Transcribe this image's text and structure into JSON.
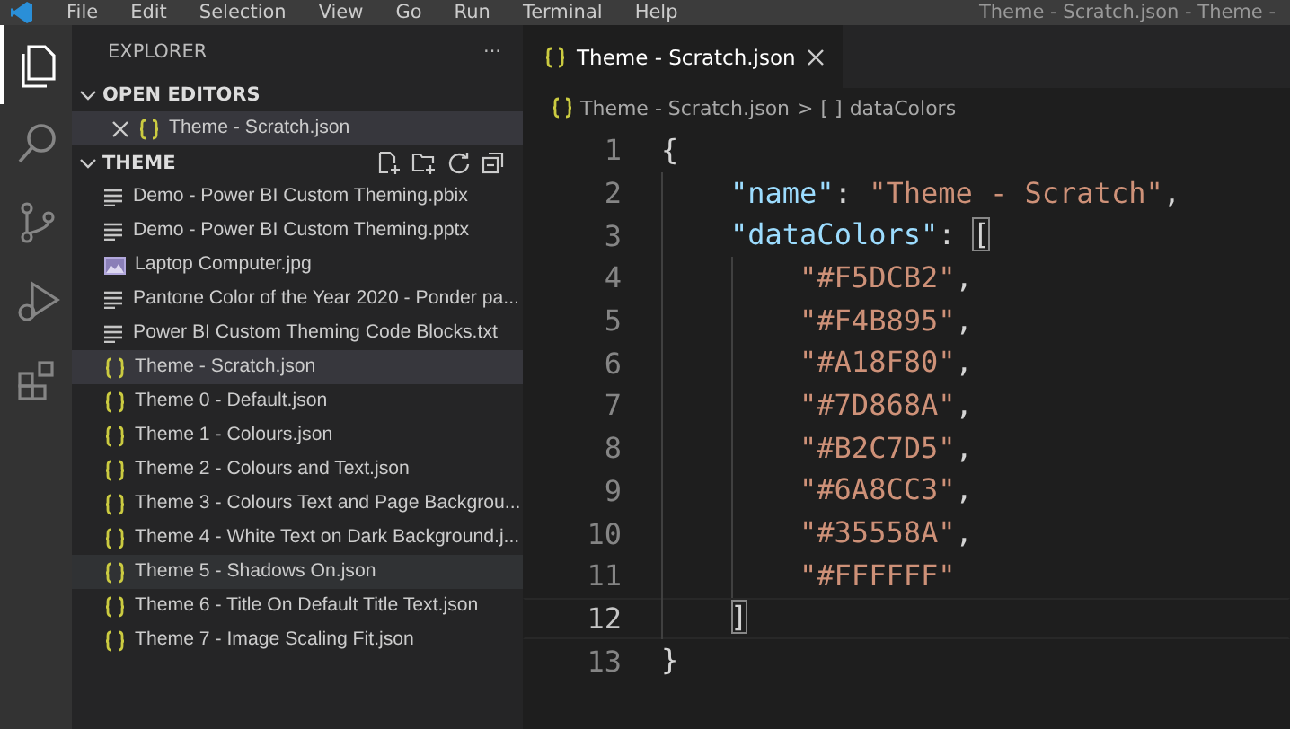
{
  "menu_bar": {
    "items": [
      "File",
      "Edit",
      "Selection",
      "View",
      "Go",
      "Run",
      "Terminal",
      "Help"
    ],
    "window_title": "Theme - Scratch.json - Theme -"
  },
  "activity_bar": [
    {
      "kind": "files",
      "selected": true
    },
    {
      "kind": "search",
      "selected": false
    },
    {
      "kind": "source-control",
      "selected": false
    },
    {
      "kind": "run",
      "selected": false
    },
    {
      "kind": "extensions",
      "selected": false
    }
  ],
  "sidebar": {
    "title": "EXPLORER",
    "more": "···",
    "open_editors": {
      "label": "OPEN EDITORS",
      "expanded": true,
      "items": [
        {
          "name": "Theme - Scratch.json",
          "kind": "json",
          "selected": true
        }
      ]
    },
    "folder": {
      "label": "THEME",
      "expanded": true,
      "items": [
        {
          "name": "Demo - Power BI Custom Theming.pbix",
          "kind": "text",
          "selected": false,
          "hovered": false
        },
        {
          "name": "Demo - Power BI Custom Theming.pptx",
          "kind": "text",
          "selected": false,
          "hovered": false
        },
        {
          "name": "Laptop Computer.jpg",
          "kind": "image",
          "selected": false,
          "hovered": false
        },
        {
          "name": "Pantone Color of the Year 2020 - Ponder pa...",
          "kind": "text",
          "selected": false,
          "hovered": false
        },
        {
          "name": "Power BI Custom Theming Code Blocks.txt",
          "kind": "text",
          "selected": false,
          "hovered": false
        },
        {
          "name": "Theme - Scratch.json",
          "kind": "json",
          "selected": true,
          "hovered": false
        },
        {
          "name": "Theme 0 - Default.json",
          "kind": "json",
          "selected": false,
          "hovered": false
        },
        {
          "name": "Theme 1 - Colours.json",
          "kind": "json",
          "selected": false,
          "hovered": false
        },
        {
          "name": "Theme 2 - Colours and Text.json",
          "kind": "json",
          "selected": false,
          "hovered": false
        },
        {
          "name": "Theme 3 - Colours Text and Page Backgrou...",
          "kind": "json",
          "selected": false,
          "hovered": false
        },
        {
          "name": "Theme 4 - White Text on Dark Background.j...",
          "kind": "json",
          "selected": false,
          "hovered": false
        },
        {
          "name": "Theme 5 - Shadows On.json",
          "kind": "json",
          "selected": false,
          "hovered": true
        },
        {
          "name": "Theme 6 - Title On Default Title Text.json",
          "kind": "json",
          "selected": false,
          "hovered": false
        },
        {
          "name": "Theme 7 - Image Scaling Fit.json",
          "kind": "json",
          "selected": false,
          "hovered": false
        }
      ]
    }
  },
  "editor": {
    "tabs": [
      {
        "label": "Theme - Scratch.json",
        "kind": "json",
        "selected": true
      }
    ],
    "breadcrumb": {
      "file": "Theme - Scratch.json",
      "separator": ">",
      "symbol_icon": "[ ]",
      "symbol": "dataColors"
    },
    "lines": [
      {
        "number": "1",
        "kind": "root",
        "current": false,
        "tokens": [
          {
            "kind": "punct",
            "text": "{"
          }
        ]
      },
      {
        "number": "2",
        "kind": "member",
        "current": false,
        "tokens": [
          {
            "kind": "key",
            "text": "\"name\""
          },
          {
            "kind": "punct",
            "text": ": "
          },
          {
            "kind": "string",
            "text": "\"Theme - Scratch\""
          },
          {
            "kind": "punct",
            "text": ","
          }
        ]
      },
      {
        "number": "3",
        "kind": "member",
        "current": false,
        "tokens": [
          {
            "kind": "key",
            "text": "\"dataColors\""
          },
          {
            "kind": "punct",
            "text": ": "
          },
          {
            "kind": "bracket-match",
            "text": "["
          }
        ]
      },
      {
        "number": "4",
        "kind": "element",
        "current": false,
        "tokens": [
          {
            "kind": "string",
            "text": "\"#F5DCB2\""
          },
          {
            "kind": "punct",
            "text": ","
          }
        ]
      },
      {
        "number": "5",
        "kind": "element",
        "current": false,
        "tokens": [
          {
            "kind": "string",
            "text": "\"#F4B895\""
          },
          {
            "kind": "punct",
            "text": ","
          }
        ]
      },
      {
        "number": "6",
        "kind": "element",
        "current": false,
        "tokens": [
          {
            "kind": "string",
            "text": "\"#A18F80\""
          },
          {
            "kind": "punct",
            "text": ","
          }
        ]
      },
      {
        "number": "7",
        "kind": "element",
        "current": false,
        "tokens": [
          {
            "kind": "string",
            "text": "\"#7D868A\""
          },
          {
            "kind": "punct",
            "text": ","
          }
        ]
      },
      {
        "number": "8",
        "kind": "element",
        "current": false,
        "tokens": [
          {
            "kind": "string",
            "text": "\"#B2C7D5\""
          },
          {
            "kind": "punct",
            "text": ","
          }
        ]
      },
      {
        "number": "9",
        "kind": "element",
        "current": false,
        "tokens": [
          {
            "kind": "string",
            "text": "\"#6A8CC3\""
          },
          {
            "kind": "punct",
            "text": ","
          }
        ]
      },
      {
        "number": "10",
        "kind": "element",
        "current": false,
        "tokens": [
          {
            "kind": "string",
            "text": "\"#35558A\""
          },
          {
            "kind": "punct",
            "text": ","
          }
        ]
      },
      {
        "number": "11",
        "kind": "element",
        "current": false,
        "tokens": [
          {
            "kind": "string",
            "text": "\"#FFFFFF\""
          }
        ]
      },
      {
        "number": "12",
        "kind": "member",
        "current": true,
        "tokens": [
          {
            "kind": "bracket-match",
            "text": "]"
          }
        ]
      },
      {
        "number": "13",
        "kind": "root",
        "current": false,
        "tokens": [
          {
            "kind": "punct",
            "text": "}"
          }
        ]
      }
    ]
  }
}
